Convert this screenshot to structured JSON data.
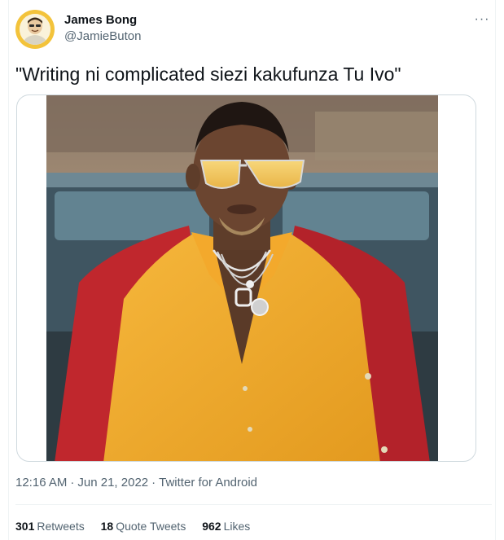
{
  "author": {
    "display_name": "James Bong",
    "handle": "@JamieButon",
    "avatar_icon": "cartoon-avatar-icon"
  },
  "menu": {
    "more_icon": "more-icon",
    "more_glyph": "···"
  },
  "tweet": {
    "text": "\"Writing ni complicated siezi kakufunza Tu Ivo\""
  },
  "media": {
    "description_icon": "photo-image"
  },
  "meta": {
    "time": "12:16 AM",
    "date": "Jun 21, 2022",
    "separator": "·",
    "source": "Twitter for Android"
  },
  "stats": {
    "retweets_count": "301",
    "retweets_label": "Retweets",
    "quotes_count": "18",
    "quotes_label": "Quote Tweets",
    "likes_count": "962",
    "likes_label": "Likes"
  },
  "colors": {
    "text_primary": "#0f1419",
    "text_secondary": "#536471",
    "border": "#cfd9de",
    "divider": "#eff3f4",
    "avatar_ring": "#f3c33b"
  }
}
